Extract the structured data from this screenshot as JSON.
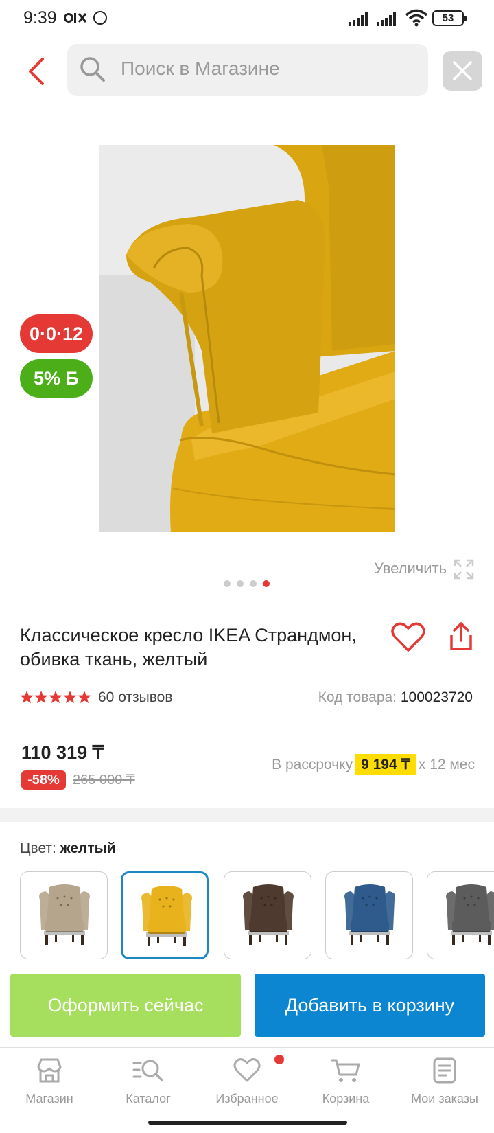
{
  "status_bar": {
    "time": "9:39",
    "app_icon_text": "OLX",
    "battery": "53"
  },
  "header": {
    "search_placeholder": "Поиск в Магазине"
  },
  "badges": {
    "installment": "0·0·12",
    "bonus": "5% Б"
  },
  "gallery": {
    "zoom_label": "Увеличить",
    "slide_count": 4,
    "active_slide": 4
  },
  "product": {
    "title": "Классическое кресло IKEA Страндмон, обивка ткань, желтый",
    "rating_stars": 5,
    "reviews": "60 отзывов",
    "sku_label": "Код товара:",
    "sku_value": "100023720"
  },
  "pricing": {
    "price": "110 319 ₸",
    "discount": "-58%",
    "old_price": "265 000 ₸",
    "installment_prefix": "В рассрочку",
    "installment_amount": "9 194 ₸",
    "installment_suffix": "x 12 мес"
  },
  "variants": {
    "label": "Цвет:",
    "selected": "желтый",
    "swatches": [
      {
        "name": "beige",
        "color": "#b5a58c"
      },
      {
        "name": "yellow",
        "color": "#e8b21c",
        "selected": true
      },
      {
        "name": "brown",
        "color": "#4e3a2e"
      },
      {
        "name": "blue",
        "color": "#2e5b8c"
      },
      {
        "name": "gray",
        "color": "#5c5c5c"
      }
    ]
  },
  "actions": {
    "order_now": "Оформить сейчас",
    "add_to_cart": "Добавить в корзину"
  },
  "tabbar": {
    "items": [
      {
        "label": "Магазин",
        "icon": "store-icon"
      },
      {
        "label": "Каталог",
        "icon": "catalog-icon"
      },
      {
        "label": "Избранное",
        "icon": "heart-icon"
      },
      {
        "label": "Корзина",
        "icon": "cart-icon"
      },
      {
        "label": "Мои заказы",
        "icon": "orders-icon"
      }
    ]
  },
  "colors": {
    "accent_red": "#e53935",
    "accent_green": "#4caf1a",
    "primary_blue": "#0d86d1",
    "order_green": "#a6df5d",
    "installment_yellow": "#ffdd00"
  }
}
